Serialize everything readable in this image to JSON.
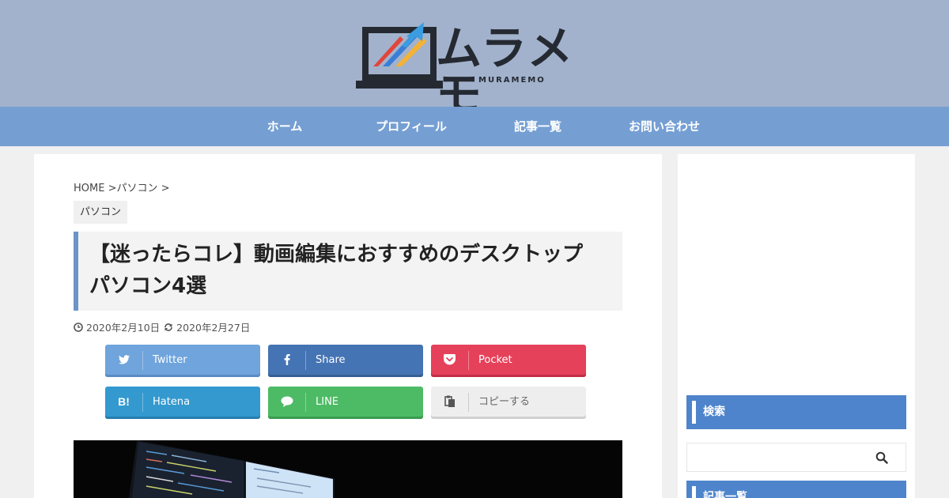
{
  "site": {
    "logo_text": "ムラメモ",
    "logo_sub": "MURAMEMO",
    "colors": {
      "header_bg": "#a2b2cc",
      "nav_bg": "#759fd3",
      "accent": "#4e84cb"
    }
  },
  "nav": {
    "items": [
      {
        "label": "ホーム"
      },
      {
        "label": "プロフィール"
      },
      {
        "label": "記事一覧"
      },
      {
        "label": "お問い合わせ"
      }
    ]
  },
  "article": {
    "breadcrumb": {
      "home": "HOME",
      "sep1": ">",
      "cat": "パソコン",
      "sep2": ">"
    },
    "category": "パソコン",
    "title_line1": "【迷ったらコレ】動画編集におすすめのデスクトップ",
    "title_line2": "パソコン4選",
    "published": "2020年2月10日",
    "updated": "2020年2月27日"
  },
  "share": {
    "buttons": [
      {
        "label": "Twitter",
        "icon": "twitter-icon",
        "color": "#6fa4dc"
      },
      {
        "label": "Share",
        "icon": "facebook-icon",
        "color": "#4574b4"
      },
      {
        "label": "Pocket",
        "icon": "pocket-icon",
        "color": "#e6415a"
      },
      {
        "label": "Hatena",
        "icon": "hatena-icon",
        "color": "#3399cf"
      },
      {
        "label": "LINE",
        "icon": "line-icon",
        "color": "#4dbb65"
      },
      {
        "label": "コピーする",
        "icon": "copy-icon",
        "color": "#eeeeee"
      }
    ]
  },
  "sidebar": {
    "search_title": "検索",
    "search_icon": "search-icon",
    "recent_title": "記事一覧"
  }
}
